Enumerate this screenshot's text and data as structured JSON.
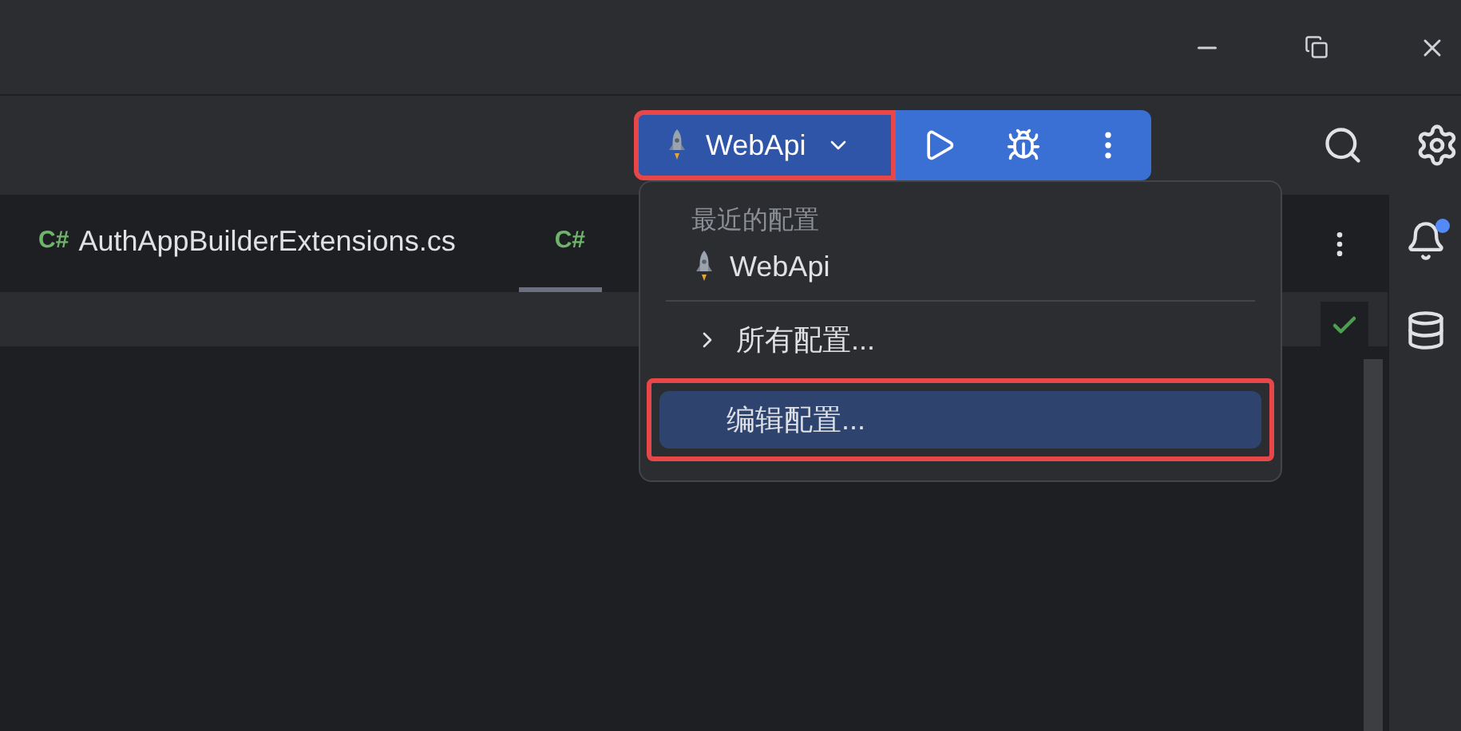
{
  "run_widget": {
    "configuration": "WebApi",
    "highlighted": true
  },
  "tabs": [
    {
      "icon_text": "C#",
      "label": "AuthAppBuilderExtensions.cs",
      "selected": false
    },
    {
      "icon_text": "C#",
      "selected": true
    }
  ],
  "notifications": {
    "unread": true
  },
  "popup": {
    "header": "最近的配置",
    "items": [
      {
        "kind": "config",
        "label": "WebApi",
        "selected": false
      },
      {
        "kind": "separator"
      },
      {
        "kind": "submenu",
        "label": "所有配置...",
        "selected": false
      },
      {
        "kind": "action",
        "label": "编辑配置...",
        "selected": true,
        "highlighted": true
      }
    ]
  }
}
